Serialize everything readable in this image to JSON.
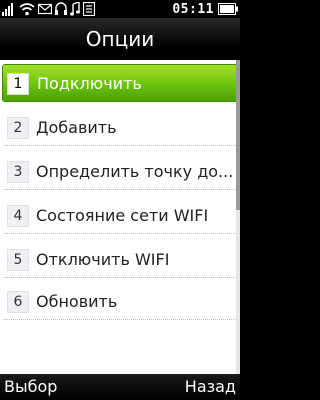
{
  "status": {
    "time": "05:11",
    "icons": [
      "signal-icon",
      "wifi-icon",
      "mail-icon",
      "headset-icon",
      "music-note-icon",
      "message-icon",
      "battery-icon"
    ]
  },
  "title": "Опции",
  "menu": {
    "items": [
      {
        "number": "1",
        "label": "Подключить",
        "selected": true
      },
      {
        "number": "2",
        "label": "Добавить"
      },
      {
        "number": "3",
        "label": "Определить точку до..."
      },
      {
        "number": "4",
        "label": "Состояние сети WIFI"
      },
      {
        "number": "5",
        "label": "Отключить WIFI"
      },
      {
        "number": "6",
        "label": "Обновить"
      }
    ]
  },
  "softkeys": {
    "left": "Выбор",
    "right": "Назад"
  },
  "colors": {
    "selection_green": "#6cc20e",
    "background": "#000000",
    "panel": "#ffffff"
  }
}
